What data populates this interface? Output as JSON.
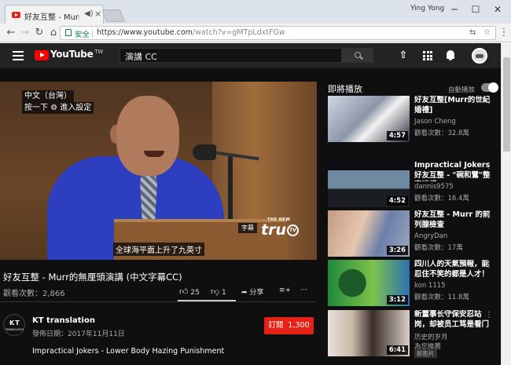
{
  "browser": {
    "tab_title": "好友互整 - Murr的無",
    "user": "Ying Yong",
    "secure_label": "安全",
    "url_host": "https://www.youtube.com",
    "url_path": "/watch?v=gMTpLdxtFGw",
    "window_controls": [
      "─",
      "☐",
      "✕"
    ]
  },
  "header": {
    "logo_text": "YouTube",
    "logo_sup": "TW",
    "search_value": "演講 CC"
  },
  "player": {
    "caption_lang": "中文（台灣）",
    "caption_hint": "按一下 ⚙ 進入設定",
    "subtitle": "全球海平面上升了九英寸",
    "subtitle_tag": "字幕",
    "watermark_small": "THE NEW",
    "watermark": "tru",
    "watermark_tv": "TV"
  },
  "video": {
    "title": "好友互整 - Murr的無厘頭演講 (中文字幕CC)",
    "views": "觀看次數：2,866",
    "likes": "25",
    "dislikes": "1",
    "share": "分享",
    "add": "≡+",
    "more": "···"
  },
  "channel": {
    "avatar_big": "KT",
    "avatar_small": "TRANSLATION",
    "name": "KT translation",
    "published": "發佈日期：2017年11月11日",
    "subscribe": "訂閱",
    "subscribers": "1,300",
    "description": "Impractical Jokers - Lower Body Hazing Punishment"
  },
  "sidebar": {
    "up_next": "即將播放",
    "autoplay": "自動播放",
    "autoplay_on": true,
    "recs": [
      {
        "title": "好友互整[Murr的世紀婚禮]",
        "channel": "Jason Cheng",
        "views": "觀看次數：32.8萬",
        "duration": "4:57",
        "new": ""
      },
      {
        "title": "Impractical Jokers 好友互整 - \"碗和鷺\"整容機構",
        "channel": "dannis9575",
        "views": "觀看次數：16.4萬",
        "duration": "4:52",
        "new": ""
      },
      {
        "title": "好友互整 - Murr 的前列腺檢查",
        "channel": "AngryDan",
        "views": "觀看次數：17萬",
        "duration": "3:26",
        "new": ""
      },
      {
        "title": "四川人的天氣預報，能忍住不笑的都是人才！",
        "channel": "kon 1115",
        "views": "觀看次數：11.8萬",
        "duration": "3:12",
        "new": ""
      },
      {
        "title": "新董事长守保安忍站岗，却被员工骂是看门",
        "channel": "历史的岁月",
        "views": "為您推薦",
        "duration": "6:41",
        "new": "新影片"
      }
    ]
  },
  "colors": {
    "brand_red": "#ff0000",
    "subscribe_red": "#e62117",
    "secure_green": "#0b8043"
  }
}
